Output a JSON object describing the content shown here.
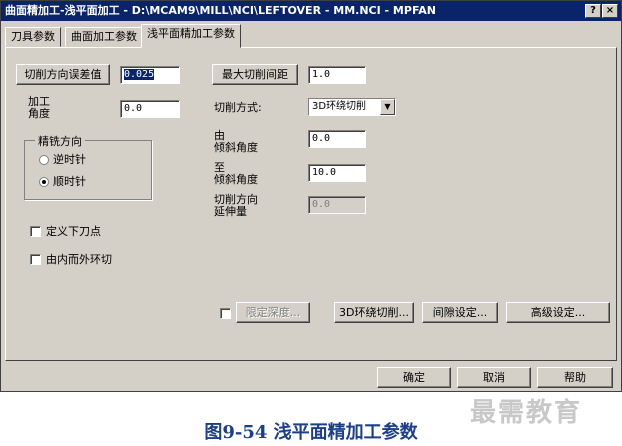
{
  "window": {
    "title": "曲面精加工-浅平面加工 - D:\\MCAM9\\MILL\\NCI\\LEFTOVER - MM.NCI - MPFAN",
    "help_label": "?",
    "close_label": "×"
  },
  "tabs": [
    {
      "label": "刀具参数"
    },
    {
      "label": "曲面加工参数"
    },
    {
      "label": "浅平面精加工参数"
    }
  ],
  "params": {
    "cut_tol_button": "切削方向误差值",
    "cut_tol_value": "0.025",
    "angle_label": "加工\n角度",
    "angle_value": "0.0",
    "max_step_button": "最大切削间距",
    "max_step_value": "1.0",
    "cut_mode_label": "切削方式:",
    "cut_mode_value": "3D环绕切削",
    "from_angle_label": "由\n倾斜角度",
    "from_angle_value": "0.0",
    "to_angle_label": "至\n倾斜角度",
    "to_angle_value": "10.0",
    "extend_label": "切削方向\n延伸量",
    "extend_value": "0.0"
  },
  "direction_group": {
    "title": "精铣方向",
    "ccw_label": "逆时针",
    "cw_label": "顺时针",
    "selected": "cw"
  },
  "options": {
    "entry_point_label": "定义下刀点",
    "inside_out_label": "由内而外环切"
  },
  "bottom_buttons": {
    "depth_limit": "限定深度...",
    "loop_cut": "3D环绕切削...",
    "gap_settings": "间隙设定...",
    "advanced": "高级设定..."
  },
  "footer_buttons": {
    "ok": "确定",
    "cancel": "取消",
    "help": "帮助"
  },
  "caption": "图9-54 浅平面精加工参数",
  "watermark": "最需教育"
}
